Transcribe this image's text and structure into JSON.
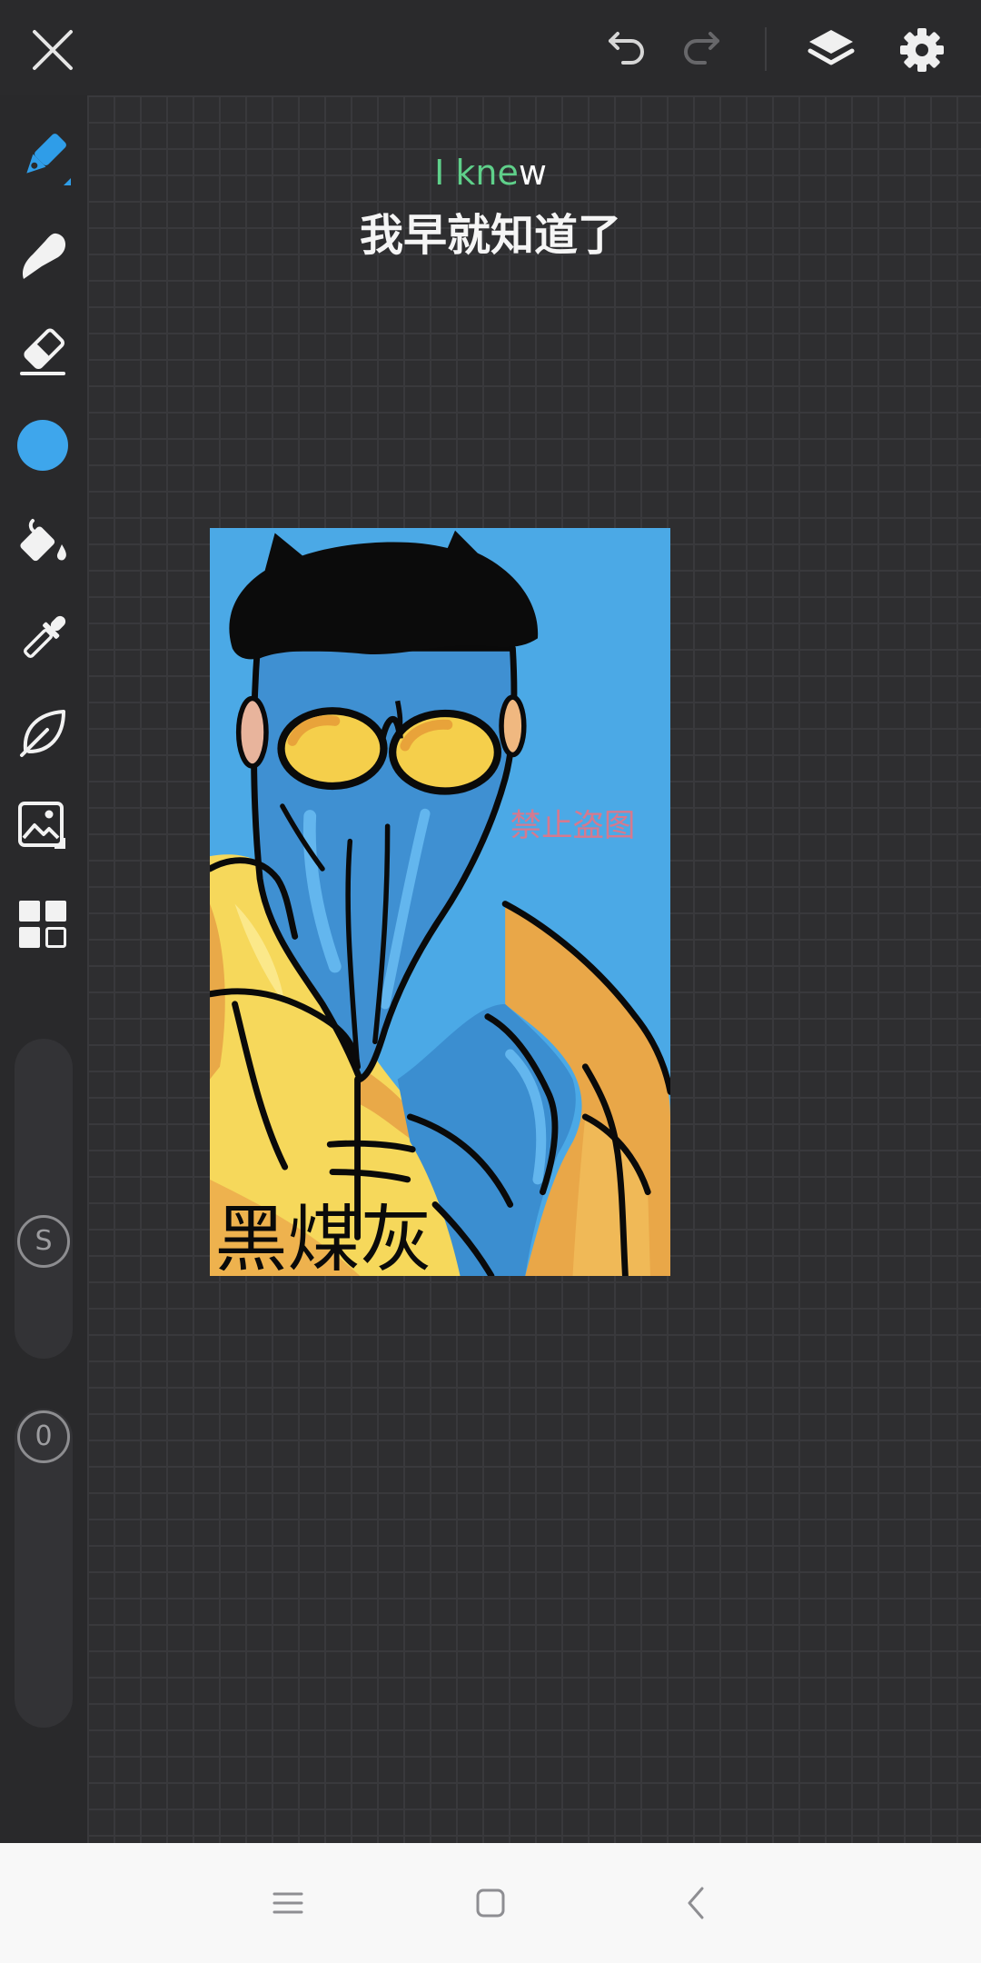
{
  "toolbar": {
    "close": {
      "icon": "close-icon"
    },
    "undo": {
      "icon": "undo-icon",
      "enabled": true
    },
    "redo": {
      "icon": "redo-icon",
      "enabled": false
    },
    "layers": {
      "icon": "layers-icon"
    },
    "settings": {
      "icon": "gear-icon"
    }
  },
  "sidebar": {
    "tools": [
      {
        "icon": "pen-icon",
        "active": true
      },
      {
        "icon": "brush-icon",
        "active": false
      },
      {
        "icon": "eraser-icon",
        "active": false
      },
      {
        "icon": "color-swatch",
        "active": false,
        "color": "#3ea6ec"
      },
      {
        "icon": "paint-bucket-icon",
        "active": false
      },
      {
        "icon": "eyedropper-icon",
        "active": false
      },
      {
        "icon": "leaf-icon",
        "active": false
      },
      {
        "icon": "image-icon",
        "active": false
      },
      {
        "icon": "grid-icon",
        "active": false
      }
    ],
    "size_slider": {
      "label": "S"
    },
    "opacity_slider": {
      "label": "0"
    }
  },
  "canvas": {
    "caption_en": "I knew",
    "caption_zh": "我早就知道了",
    "artwork": {
      "watermark": "禁止盗图",
      "signature": "黑煤灰"
    }
  },
  "navbar": {
    "buttons": [
      {
        "icon": "menu-icon"
      },
      {
        "icon": "home-square-icon"
      },
      {
        "icon": "back-icon"
      }
    ]
  },
  "colors": {
    "accent": "#2f9de8",
    "current_color": "#3ea6ec",
    "caption_en": "#5fd08a",
    "watermark": "#e57384",
    "canvas_background": "#2e2e30",
    "navbar_background": "#f8f8f8"
  }
}
